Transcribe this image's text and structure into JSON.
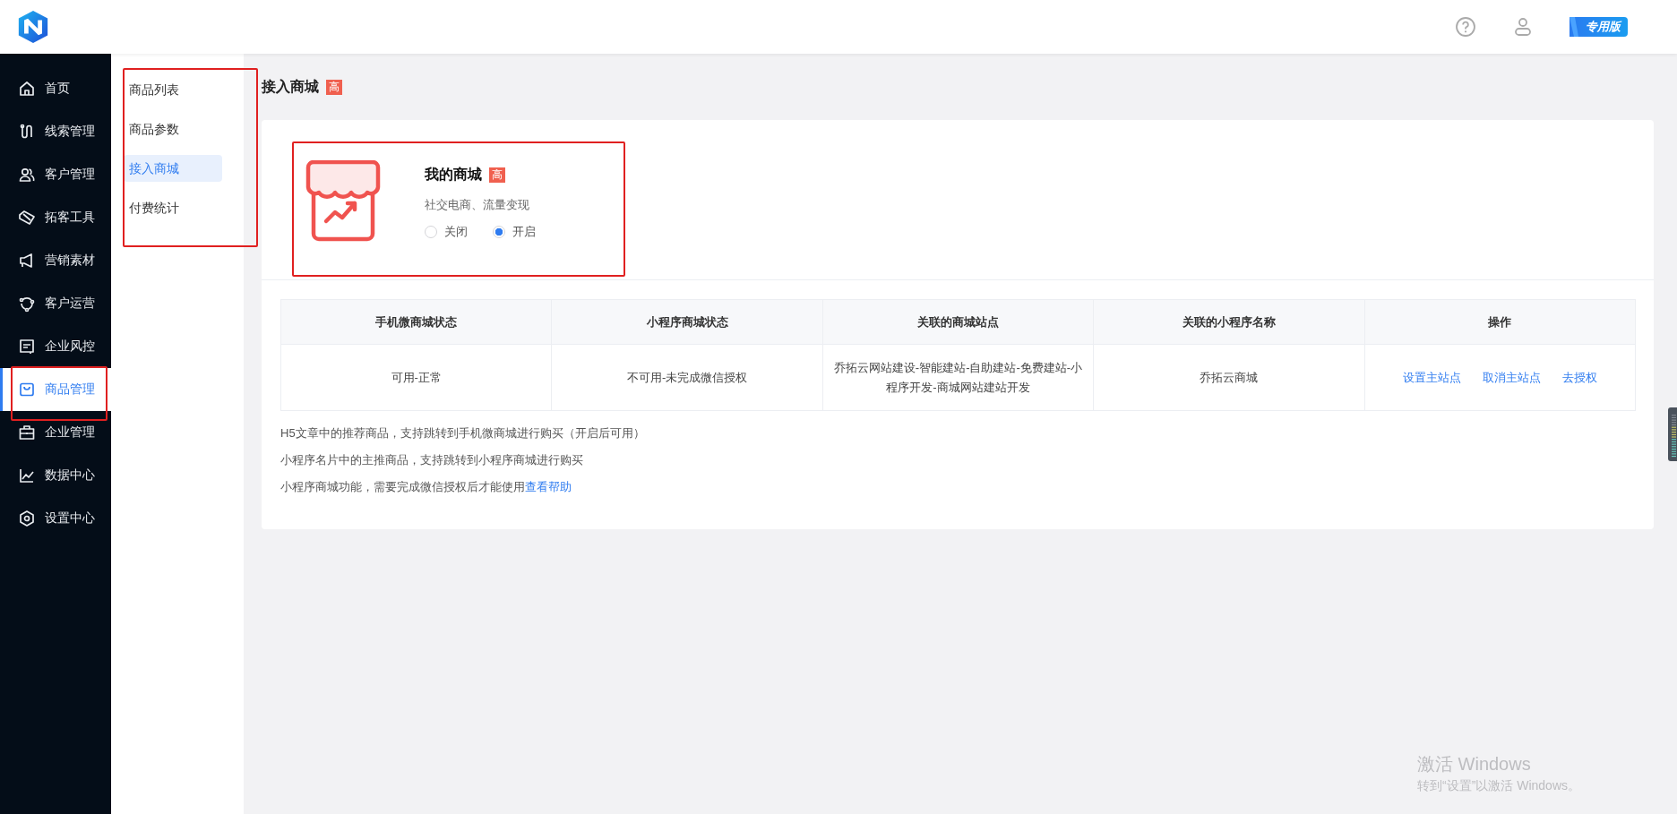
{
  "header": {
    "badge": "专用版"
  },
  "nav": [
    {
      "label": "首页",
      "selected": false
    },
    {
      "label": "线索管理",
      "selected": false
    },
    {
      "label": "客户管理",
      "selected": false
    },
    {
      "label": "拓客工具",
      "selected": false
    },
    {
      "label": "营销素材",
      "selected": false
    },
    {
      "label": "客户运营",
      "selected": false
    },
    {
      "label": "企业风控",
      "selected": false
    },
    {
      "label": "商品管理",
      "selected": true
    },
    {
      "label": "企业管理",
      "selected": false
    },
    {
      "label": "数据中心",
      "selected": false
    },
    {
      "label": "设置中心",
      "selected": false
    }
  ],
  "subnav": [
    {
      "label": "商品列表",
      "selected": false
    },
    {
      "label": "商品参数",
      "selected": false
    },
    {
      "label": "接入商城",
      "selected": true
    },
    {
      "label": "付费统计",
      "selected": false
    }
  ],
  "page_title": "接入商城",
  "page_tag": "高",
  "mall": {
    "name": "我的商城",
    "tag": "高",
    "subtitle": "社交电商、流量变现",
    "options": [
      {
        "label": "关闭",
        "selected": false
      },
      {
        "label": "开启",
        "selected": true
      }
    ]
  },
  "table": {
    "columns": [
      "手机微商城状态",
      "小程序商城状态",
      "关联的商城站点",
      "关联的小程序名称",
      "操作"
    ],
    "rows": [
      {
        "cells": [
          "可用-正常",
          "不可用-未完成微信授权",
          "乔拓云网站建设-智能建站-自助建站-免费建站-小程序开发-商城网站建站开发",
          "乔拓云商城"
        ],
        "actions": [
          "设置主站点",
          "取消主站点",
          "去授权"
        ]
      }
    ]
  },
  "notes": [
    {
      "text": "H5文章中的推荐商品，支持跳转到手机微商城进行购买（开启后可用）"
    },
    {
      "text": "小程序名片中的主推商品，支持跳转到小程序商城进行购买"
    },
    {
      "text": "小程序商城功能，需要完成微信授权后才能使用",
      "link": "查看帮助"
    }
  ],
  "watermark": {
    "title": "激活 Windows",
    "subtitle": "转到“设置”以激活 Windows。"
  }
}
